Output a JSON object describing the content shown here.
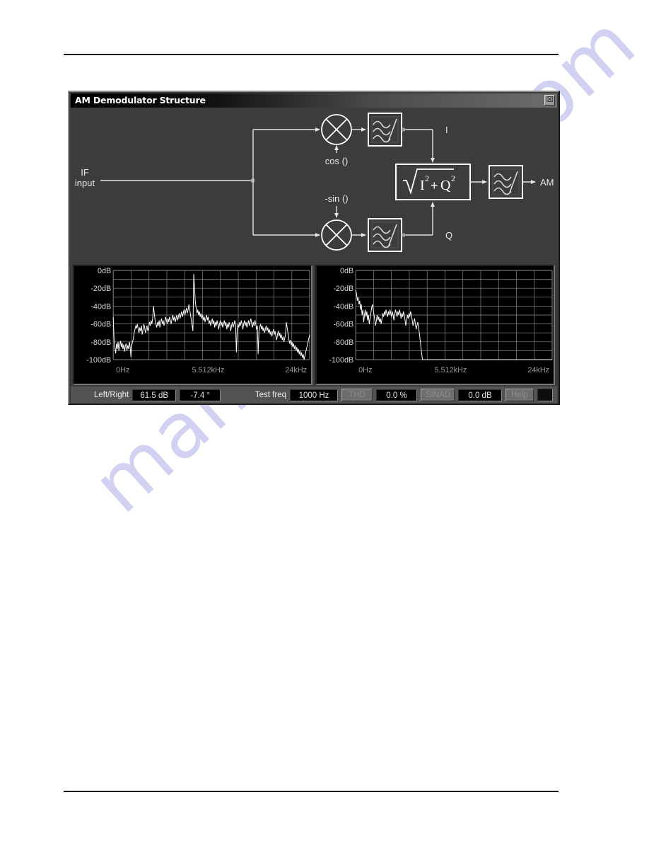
{
  "window": {
    "title": "AM Demodulator Structure",
    "close_label": "☒"
  },
  "diagram": {
    "input_line1": "IF",
    "input_line2": "input",
    "cos_label": "cos ()",
    "nsin_label": "-sin ()",
    "i_label": "I",
    "q_label": "Q",
    "output_label": "AM",
    "magnitude_formula": "√ I²+Q²",
    "blocks": [
      {
        "name": "mixer-i",
        "type": "multiplier"
      },
      {
        "name": "mixer-q",
        "type": "multiplier"
      },
      {
        "name": "lowpass-i",
        "type": "filter"
      },
      {
        "name": "lowpass-q",
        "type": "filter"
      },
      {
        "name": "magnitude",
        "type": "sqrt-sum-squares"
      },
      {
        "name": "output-filter",
        "type": "filter"
      }
    ]
  },
  "status_bar": {
    "left_right_label": "Left/Right",
    "left_right_value": "61.5 dB",
    "phase_value": "-7.4 °",
    "test_freq_label": "Test freq",
    "test_freq_value": "1000 Hz",
    "thd_button": "THD",
    "thd_value": "0.0 %",
    "sinad_button": "SINAD",
    "sinad_value": "0.0 dB",
    "help_button": "Help"
  },
  "watermark": {
    "text": "manualshive.com"
  },
  "chart_data": [
    {
      "name": "if-input-spectrum",
      "type": "line",
      "title": "",
      "xlabel": "",
      "ylabel": "",
      "xtick_labels": [
        "0Hz",
        "5.512kHz",
        "24kHz"
      ],
      "ytick_labels": [
        "0dB",
        "-20dB",
        "-40dB",
        "-60dB",
        "-80dB",
        "-100dB"
      ],
      "xlim": [
        0,
        24000
      ],
      "ylim": [
        -110,
        0
      ],
      "grid": true,
      "x_gridlines": 11,
      "y_gridlines": 10,
      "values": [
        -52,
        -78,
        -86,
        -93,
        -82,
        -88,
        -80,
        -90,
        -84,
        -79,
        -86,
        -81,
        -88,
        -83,
        -91,
        -85,
        -82,
        -90,
        -84,
        -88,
        -80,
        -86,
        -97,
        -84,
        -80,
        -76,
        -70,
        -66,
        -62,
        -65,
        -60,
        -66,
        -70,
        -64,
        -68,
        -62,
        -72,
        -66,
        -60,
        -64,
        -70,
        -66,
        -62,
        -68,
        -64,
        -58,
        -62,
        -56,
        -60,
        -54,
        -40,
        -48,
        -56,
        -60,
        -64,
        -58,
        -62,
        -56,
        -64,
        -58,
        -54,
        -60,
        -56,
        -62,
        -58,
        -52,
        -56,
        -60,
        -54,
        -58,
        -52,
        -56,
        -60,
        -54,
        -50,
        -56,
        -52,
        -58,
        -54,
        -50,
        -56,
        -52,
        -48,
        -54,
        -50,
        -46,
        -52,
        -48,
        -44,
        -50,
        -46,
        -42,
        -48,
        -44,
        -38,
        -44,
        -50,
        -56,
        -62,
        -68,
        -4,
        -20,
        -36,
        -42,
        -48,
        -44,
        -50,
        -46,
        -52,
        -48,
        -54,
        -50,
        -56,
        -52,
        -58,
        -54,
        -50,
        -56,
        -52,
        -60,
        -56,
        -62,
        -58,
        -54,
        -60,
        -56,
        -64,
        -58,
        -62,
        -56,
        -60,
        -66,
        -60,
        -56,
        -62,
        -58,
        -64,
        -60,
        -56,
        -62,
        -58,
        -66,
        -60,
        -64,
        -58,
        -62,
        -68,
        -62,
        -58,
        -64,
        -60,
        -56,
        -62,
        -92,
        -66,
        -60,
        -64,
        -58,
        -62,
        -56,
        -60,
        -66,
        -60,
        -56,
        -62,
        -58,
        -64,
        -60,
        -56,
        -62,
        -58,
        -54,
        -60,
        -64,
        -58,
        -62,
        -56,
        -60,
        -66,
        -62,
        -94,
        -68,
        -64,
        -60,
        -66,
        -62,
        -68,
        -64,
        -70,
        -66,
        -62,
        -68,
        -64,
        -70,
        -66,
        -72,
        -68,
        -74,
        -70,
        -66,
        -72,
        -68,
        -74,
        -78,
        -72,
        -68,
        -74,
        -70,
        -76,
        -72,
        -78,
        -74,
        -80,
        -76,
        -72,
        -58,
        -64,
        -70,
        -76,
        -82,
        -78,
        -84,
        -80,
        -86,
        -82,
        -88,
        -84,
        -90,
        -86,
        -92,
        -88,
        -94,
        -90,
        -96,
        -92,
        -98,
        -94,
        -100,
        -96,
        -92,
        -88,
        -84,
        -80,
        -76,
        -72
      ]
    },
    {
      "name": "am-output-spectrum",
      "type": "line",
      "title": "",
      "xlabel": "",
      "ylabel": "",
      "xtick_labels": [
        "0Hz",
        "5.512kHz",
        "24kHz"
      ],
      "ytick_labels": [
        "0dB",
        "-20dB",
        "-40dB",
        "-60dB",
        "-80dB",
        "-100dB"
      ],
      "xlim": [
        0,
        24000
      ],
      "ylim": [
        -110,
        0
      ],
      "grid": true,
      "x_gridlines": 11,
      "y_gridlines": 10,
      "values": [
        -22,
        -26,
        -34,
        -30,
        -38,
        -34,
        -44,
        -38,
        -50,
        -44,
        -58,
        -50,
        -44,
        -52,
        -46,
        -56,
        -50,
        -60,
        -54,
        -48,
        -42,
        -38,
        -44,
        -50,
        -56,
        -62,
        -56,
        -50,
        -56,
        -52,
        -58,
        -54,
        -60,
        -54,
        -48,
        -52,
        -46,
        -50,
        -44,
        -48,
        -52,
        -46,
        -50,
        -44,
        -48,
        -52,
        -46,
        -50,
        -56,
        -50,
        -44,
        -48,
        -52,
        -46,
        -50,
        -44,
        -48,
        -54,
        -48,
        -52,
        -46,
        -50,
        -56,
        -62,
        -56,
        -50,
        -54,
        -48,
        -52,
        -46,
        -50,
        -56,
        -62,
        -58,
        -54,
        -60,
        -66,
        -62,
        -58,
        -64,
        -70,
        -78,
        -86,
        -94,
        -100,
        -106,
        -108,
        -108,
        -108,
        -108,
        -108,
        -108,
        -108,
        -108,
        -108,
        -108,
        -108,
        -108,
        -108,
        -108,
        -108,
        -108,
        -108,
        -108,
        -108,
        -108,
        -108,
        -108,
        -108,
        -108,
        -108,
        -108,
        -108,
        -108,
        -108,
        -108,
        -108,
        -108,
        -108,
        -108,
        -108,
        -108,
        -108,
        -108,
        -108,
        -108,
        -108,
        -108,
        -108,
        -108,
        -108,
        -108,
        -108,
        -108,
        -108,
        -108,
        -108,
        -108,
        -108,
        -108,
        -108,
        -108,
        -108,
        -108,
        -108,
        -108,
        -108,
        -108,
        -108,
        -108,
        -108,
        -108,
        -108,
        -108,
        -108,
        -108,
        -108,
        -108,
        -108,
        -108,
        -108,
        -108,
        -108,
        -108,
        -108,
        -108,
        -108,
        -108,
        -108,
        -108,
        -108,
        -108,
        -108,
        -108,
        -108,
        -108,
        -108,
        -108,
        -108,
        -108,
        -108,
        -108,
        -108,
        -108,
        -108,
        -108,
        -108,
        -108,
        -108,
        -108,
        -108,
        -108,
        -108,
        -108,
        -108,
        -108,
        -108,
        -108,
        -108,
        -108,
        -108,
        -108,
        -108,
        -108,
        -108,
        -108,
        -108,
        -108,
        -108,
        -108,
        -108,
        -108,
        -108,
        -108,
        -108,
        -108,
        -108,
        -108,
        -108,
        -108,
        -108,
        -108,
        -108,
        -108,
        -108,
        -108,
        -108,
        -108,
        -108,
        -108,
        -108,
        -108,
        -108,
        -108,
        -108,
        -108,
        -108,
        -108,
        -108,
        -108,
        -108,
        -108,
        -108,
        -108,
        -108,
        -108,
        -108,
        -108
      ]
    }
  ]
}
